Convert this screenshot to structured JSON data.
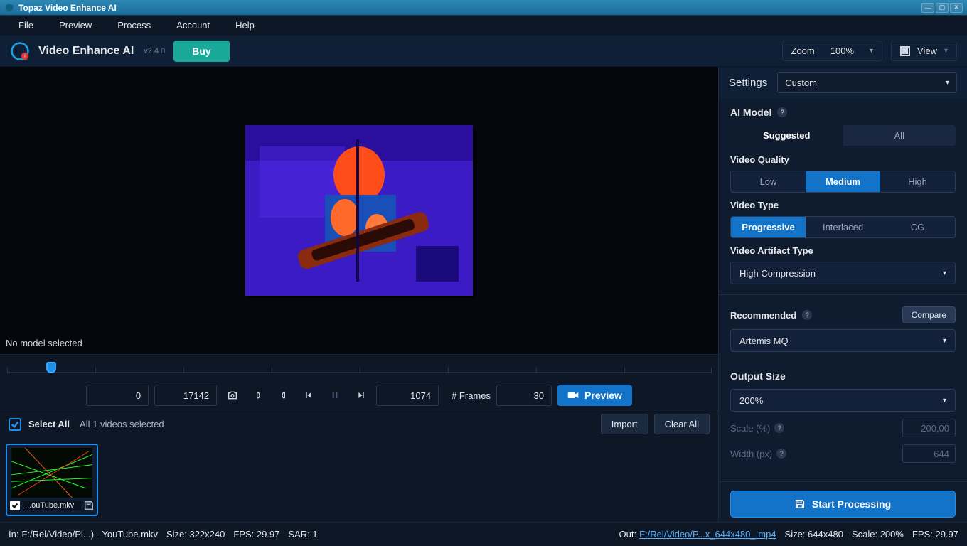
{
  "titlebar": {
    "title": "Topaz Video Enhance AI"
  },
  "menu": {
    "file": "File",
    "preview": "Preview",
    "process": "Process",
    "account": "Account",
    "help": "Help"
  },
  "appbar": {
    "name": "Video Enhance AI",
    "version": "v2.4.0",
    "buy": "Buy",
    "zoom_label": "Zoom",
    "zoom_value": "100%",
    "view_label": "View"
  },
  "preview": {
    "model_label": "No model selected"
  },
  "controls": {
    "start": "0",
    "end": "17142",
    "current": "1074",
    "frames_label": "# Frames",
    "frames": "30",
    "preview_btn": "Preview"
  },
  "list": {
    "select_all": "Select All",
    "summary": "All 1 videos selected",
    "import": "Import",
    "clear": "Clear All"
  },
  "thumb": {
    "name": "...ouTube.mkv"
  },
  "settings": {
    "label": "Settings",
    "preset": "Custom",
    "ai_model": "AI Model",
    "tab_suggested": "Suggested",
    "tab_all": "All",
    "video_quality": "Video Quality",
    "q_low": "Low",
    "q_med": "Medium",
    "q_high": "High",
    "video_type": "Video Type",
    "t_prog": "Progressive",
    "t_int": "Interlaced",
    "t_cg": "CG",
    "artifact": "Video Artifact Type",
    "artifact_val": "High Compression",
    "recommended": "Recommended",
    "compare": "Compare",
    "rec_model": "Artemis MQ",
    "output_size": "Output Size",
    "size_preset": "200%",
    "scale_lbl": "Scale (%)",
    "scale_val": "200,00",
    "width_lbl": "Width (px)",
    "width_val": "644",
    "start_btn": "Start Processing"
  },
  "status": {
    "in_lbl": "In:",
    "in_path": "F:/Rel/Video/Pi...) - YouTube.mkv",
    "in_size": "Size: 322x240",
    "in_fps": "FPS: 29.97",
    "in_sar": "SAR: 1",
    "out_lbl": "Out:",
    "out_path": "F:/Rel/Video/P...x_644x480_.mp4",
    "out_size": "Size: 644x480",
    "out_scale": "Scale: 200%",
    "out_fps": "FPS: 29.97"
  }
}
